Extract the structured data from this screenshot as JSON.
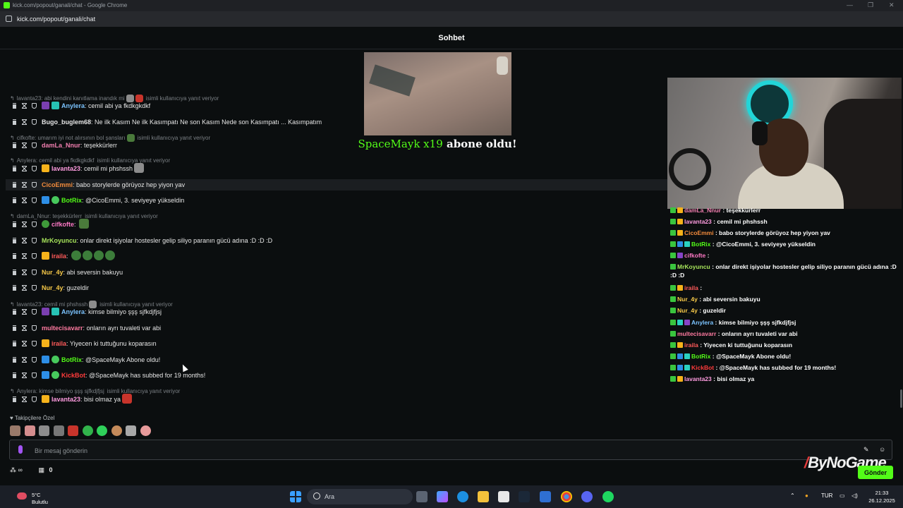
{
  "browser": {
    "window_title": "kick.com/popout/ganali/chat - Google Chrome",
    "url": "kick.com/popout/ganali/chat"
  },
  "chat": {
    "header_title": "Sohbet",
    "alert": {
      "name": "SpaceMayk x19",
      "text": "abone oldu!"
    },
    "messages": [
      {
        "reply": "lavanta23: abi kendini kanıtlama inandık mi",
        "user": "Anylera",
        "user_color": "#7cc4ff",
        "badges": [
          "og",
          "gift"
        ],
        "text": "cemil abi ya fkdkgkdkf"
      },
      {
        "user": "Bugo_buglem68",
        "user_color": "#e6e6e6",
        "badges": [],
        "text": "Ne ilk Kasım Ne ilk Kasımpatı Ne son Kasım Nede son Kasımpatı ... Kasımpatım"
      },
      {
        "reply": "cifkofte: umarım iyi not alırsının bol şansları",
        "user": "damLa_Nnur",
        "user_color": "#f27fb0",
        "badges": [],
        "text": "teşekkürlerr"
      },
      {
        "reply": "Anylera: cemil abi ya fkdkgkdkf",
        "user": "lavanta23",
        "user_color": "#ff9ce0",
        "badges": [
          "crown"
        ],
        "text": "cemil mi phshssh"
      },
      {
        "user": "CicoEmmi",
        "user_color": "#f28b3c",
        "badges": [],
        "text": "babo storylerde görüyoz hep yiyon yav",
        "highlight": true
      },
      {
        "user": "BotRix",
        "user_color": "#53fc18",
        "badges": [
          "sword",
          "ver"
        ],
        "text": "@CicoEmmi, 3. seviyeye yükseldin"
      },
      {
        "reply": "damLa_Nnur: teşekkürlerr",
        "user": "cifkofte",
        "user_color": "#ff79c6",
        "badges": [
          "pepe"
        ],
        "text": ""
      },
      {
        "user": "MrKoyuncu",
        "user_color": "#a6e35a",
        "badges": [],
        "text": "onlar direkt işiyolar hostesler gelip siliyo paranın gücü adına :D :D :D"
      },
      {
        "user": "iraila",
        "user_color": "#ff5a5a",
        "badges": [
          "crown"
        ],
        "text": ""
      },
      {
        "user": "Nur_4y",
        "user_color": "#f7c948",
        "badges": [],
        "text": "abi seversin bakuyu"
      },
      {
        "user": "Nur_4y",
        "user_color": "#f7c948",
        "badges": [],
        "text": "guzeldir"
      },
      {
        "reply": "lavanta23: cemil mi phshssh",
        "user": "Anylera",
        "user_color": "#7cc4ff",
        "badges": [
          "og",
          "gift"
        ],
        "text": "kimse bilmiyo şşş sjfkdjfjsj"
      },
      {
        "user": "multecisavarr",
        "user_color": "#ff7aa0",
        "badges": [],
        "text": "onların ayrı tuvaleti var abi"
      },
      {
        "user": "iraila",
        "user_color": "#ff5a5a",
        "badges": [
          "crown"
        ],
        "text": "Yiyecen ki tuttuğunu koparasın"
      },
      {
        "user": "BotRix",
        "user_color": "#53fc18",
        "badges": [
          "sword",
          "ver"
        ],
        "text": "@SpaceMayk Abone oldu!"
      },
      {
        "user": "KickBot",
        "user_color": "#ff3b3b",
        "badges": [
          "sword",
          "ver"
        ],
        "text": "@SpaceMayk has subbed for 19 months!"
      },
      {
        "reply": "Anylera: kimse bilmiyo şşş sjfkdjfjsj",
        "user": "lavanta23",
        "user_color": "#ff9ce0",
        "badges": [
          "crown"
        ],
        "text": "bisi olmaz ya"
      }
    ],
    "reply_suffix": "isimli kullanıcıya yanıt veriyor",
    "followers_label": "Takipçilere Özel",
    "input_placeholder": "Bir mesaj gönderin",
    "send_label": "Gönder",
    "count": "0"
  },
  "overlay": {
    "rows": [
      {
        "user": "damLa_Nnur",
        "text": "teşekkürlerr",
        "color": "#f27fb0"
      },
      {
        "user": "lavanta23",
        "text": "cemil mi phshssh",
        "color": "#ff9ce0"
      },
      {
        "user": "CicoEmmi",
        "text": "babo storylerde görüyoz hep yiyon yav",
        "color": "#f28b3c"
      },
      {
        "user": "BotRix",
        "text": "@CicoEmmi, 3. seviyeye yükseldin",
        "color": "#53fc18"
      },
      {
        "user": "cifkofte",
        "text": "",
        "color": "#ff79c6"
      },
      {
        "user": "MrKoyuncu",
        "text": "onlar direkt işiyolar hostesler gelip siliyo paranın gücü adına :D",
        "color": "#a6e35a"
      },
      {
        "user": "",
        "text": ":D :D",
        "color": "#a6e35a"
      },
      {
        "user": "iraila",
        "text": "",
        "color": "#ff5a5a"
      },
      {
        "user": "Nur_4y",
        "text": "abi seversin bakuyu",
        "color": "#f7c948"
      },
      {
        "user": "Nur_4y",
        "text": "guzeldir",
        "color": "#f7c948"
      },
      {
        "user": "Anylera",
        "text": "kimse bilmiyo şşş sjfkdjfjsj",
        "color": "#7cc4ff"
      },
      {
        "user": "multecisavarr",
        "text": "onların ayrı tuvaleti var abi",
        "color": "#ff7aa0"
      },
      {
        "user": "iraila",
        "text": "Yiyecen ki tuttuğunu koparasın",
        "color": "#ff5a5a"
      },
      {
        "user": "BotRix",
        "text": "@SpaceMayk Abone oldu!",
        "color": "#53fc18"
      },
      {
        "user": "KickBot",
        "text": "@SpaceMayk has subbed for 19 months!",
        "color": "#ff3b3b"
      },
      {
        "user": "lavanta23",
        "text": "bisi olmaz ya",
        "color": "#ff9ce0"
      }
    ]
  },
  "watermark": "ByNoGame",
  "taskbar": {
    "temp": "5°C",
    "condition": "Bulutlu",
    "search_placeholder": "Ara",
    "lang": "TUR",
    "time": "21:33",
    "date": "26.12.2025"
  },
  "colors": {
    "accent": "#53fc18",
    "background": "#0b0e0f"
  }
}
